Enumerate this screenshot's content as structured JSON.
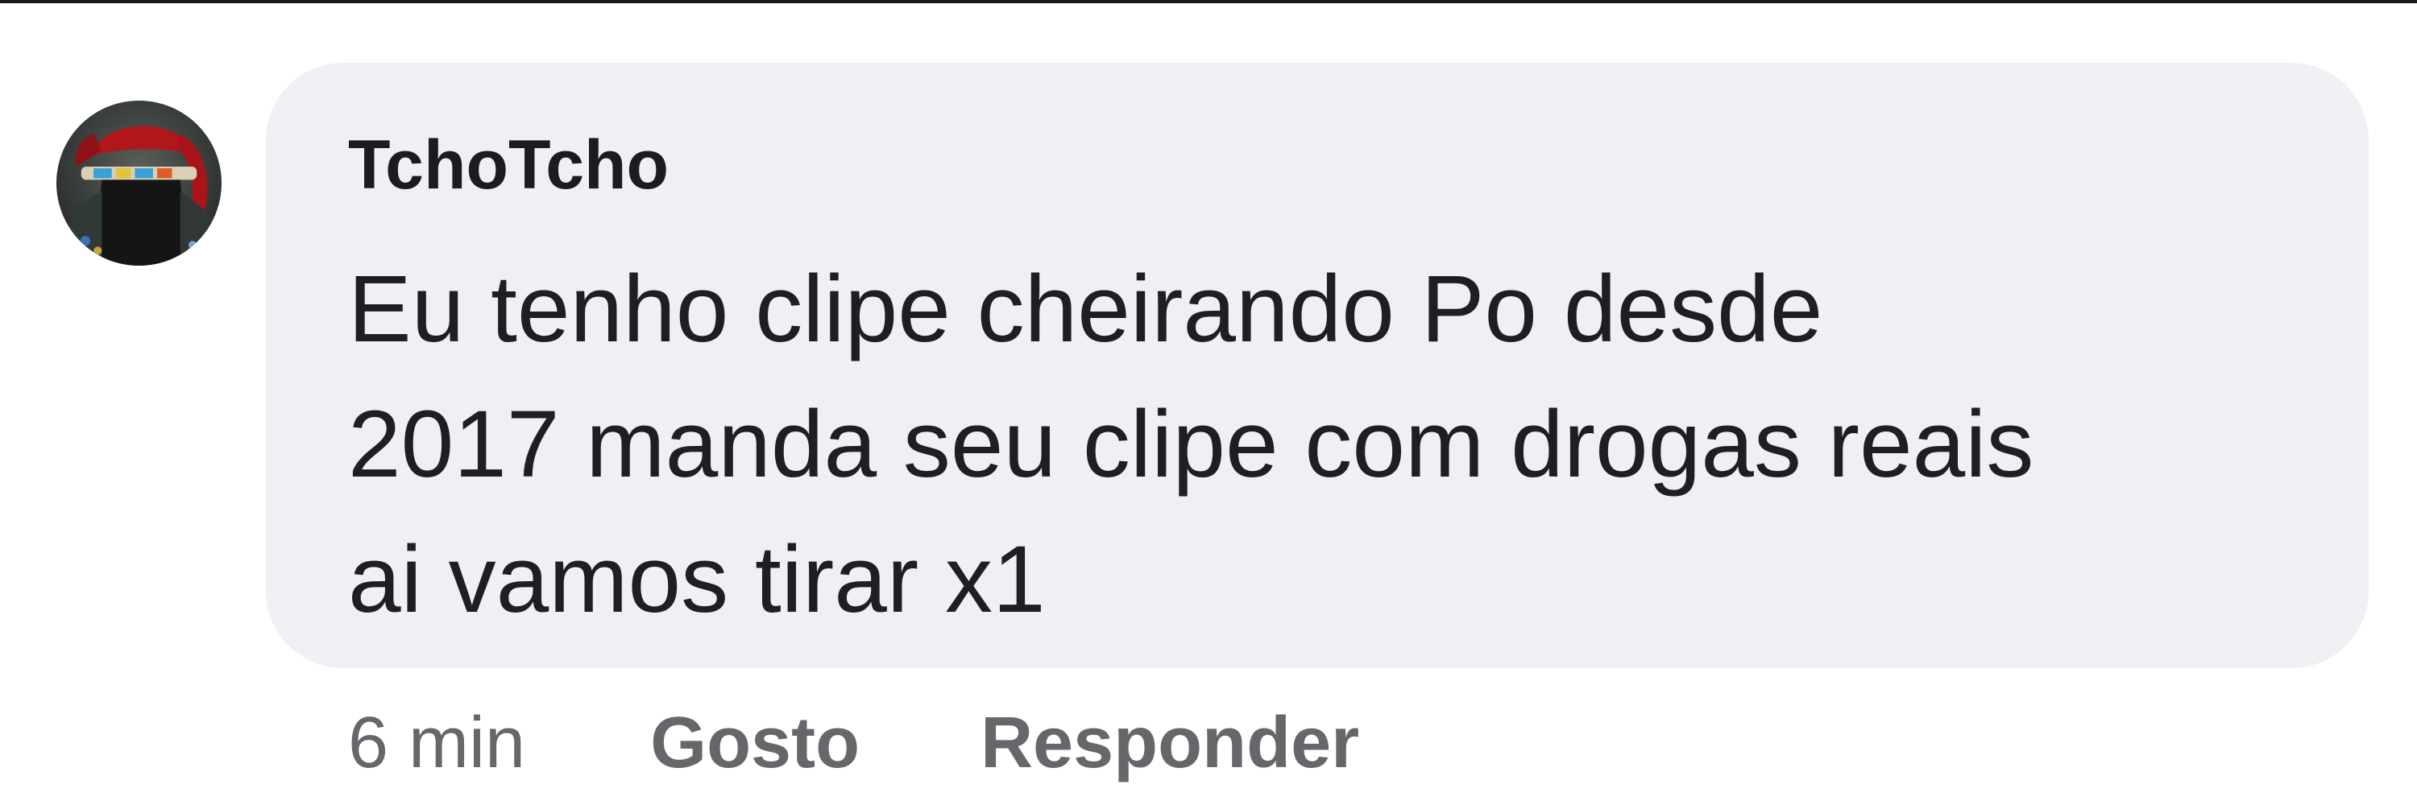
{
  "comment": {
    "author": "TchoTcho",
    "text_lines": [
      "Eu tenho clipe cheirando Po desde",
      "2017 manda seu clipe com drogas reais",
      "ai vamos tirar x1"
    ],
    "timestamp": "6 min",
    "like_label": "Gosto",
    "reply_label": "Responder"
  },
  "colors": {
    "bubble_background": "#eff0f3",
    "text": "#1e1f22",
    "action_text": "#65676b"
  },
  "icons": {
    "avatar": "user-avatar-photo"
  }
}
